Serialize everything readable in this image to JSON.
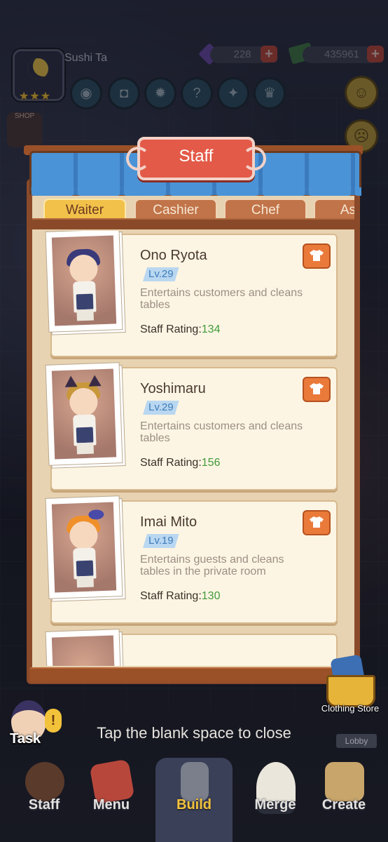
{
  "hud": {
    "restaurant_name": "Sushi Ta",
    "gems": "228",
    "cash": "435961",
    "stars": "★★★",
    "buttons": [
      "eye-icon",
      "camera-icon",
      "gear-icon",
      "help-icon",
      "book-icon",
      "trophy-icon"
    ]
  },
  "panel": {
    "title": "Staff",
    "tabs": [
      {
        "label": "Waiter",
        "active": true
      },
      {
        "label": "Cashier",
        "active": false
      },
      {
        "label": "Chef",
        "active": false
      },
      {
        "label": "Asse",
        "active": false
      }
    ],
    "staff": [
      {
        "name": "Ono Ryota",
        "level": "Lv.29",
        "description": "Entertains customers and cleans tables",
        "rating_label": "Staff Rating:",
        "rating": "134"
      },
      {
        "name": "Yoshimaru",
        "level": "Lv.29",
        "description": "Entertains customers and cleans tables",
        "rating_label": "Staff Rating:",
        "rating": "156"
      },
      {
        "name": "Imai Mito",
        "level": "Lv.19",
        "description": "Entertains guests and cleans tables in the private room",
        "rating_label": "Staff Rating:",
        "rating": "130"
      }
    ]
  },
  "clothing_store_label": "Clothing Store",
  "close_hint": "Tap the blank space to close",
  "side": {
    "shop_label": "SHOP",
    "lobby_label": "Lobby",
    "task_label": "Task"
  },
  "nav": [
    {
      "label": "Staff",
      "icon": "staff-icon"
    },
    {
      "label": "Menu",
      "icon": "menu-book-icon"
    },
    {
      "label": "Build",
      "icon": "hammer-icon"
    },
    {
      "label": "Merge",
      "icon": "onigiri-icon"
    },
    {
      "label": "Create",
      "icon": "sushi-platter-icon"
    }
  ],
  "colors": {
    "accent_red": "#e35a48",
    "tab_active": "#f2c14a",
    "rating_green": "#3f9b3a",
    "level_blue": "#3e7cb8"
  }
}
